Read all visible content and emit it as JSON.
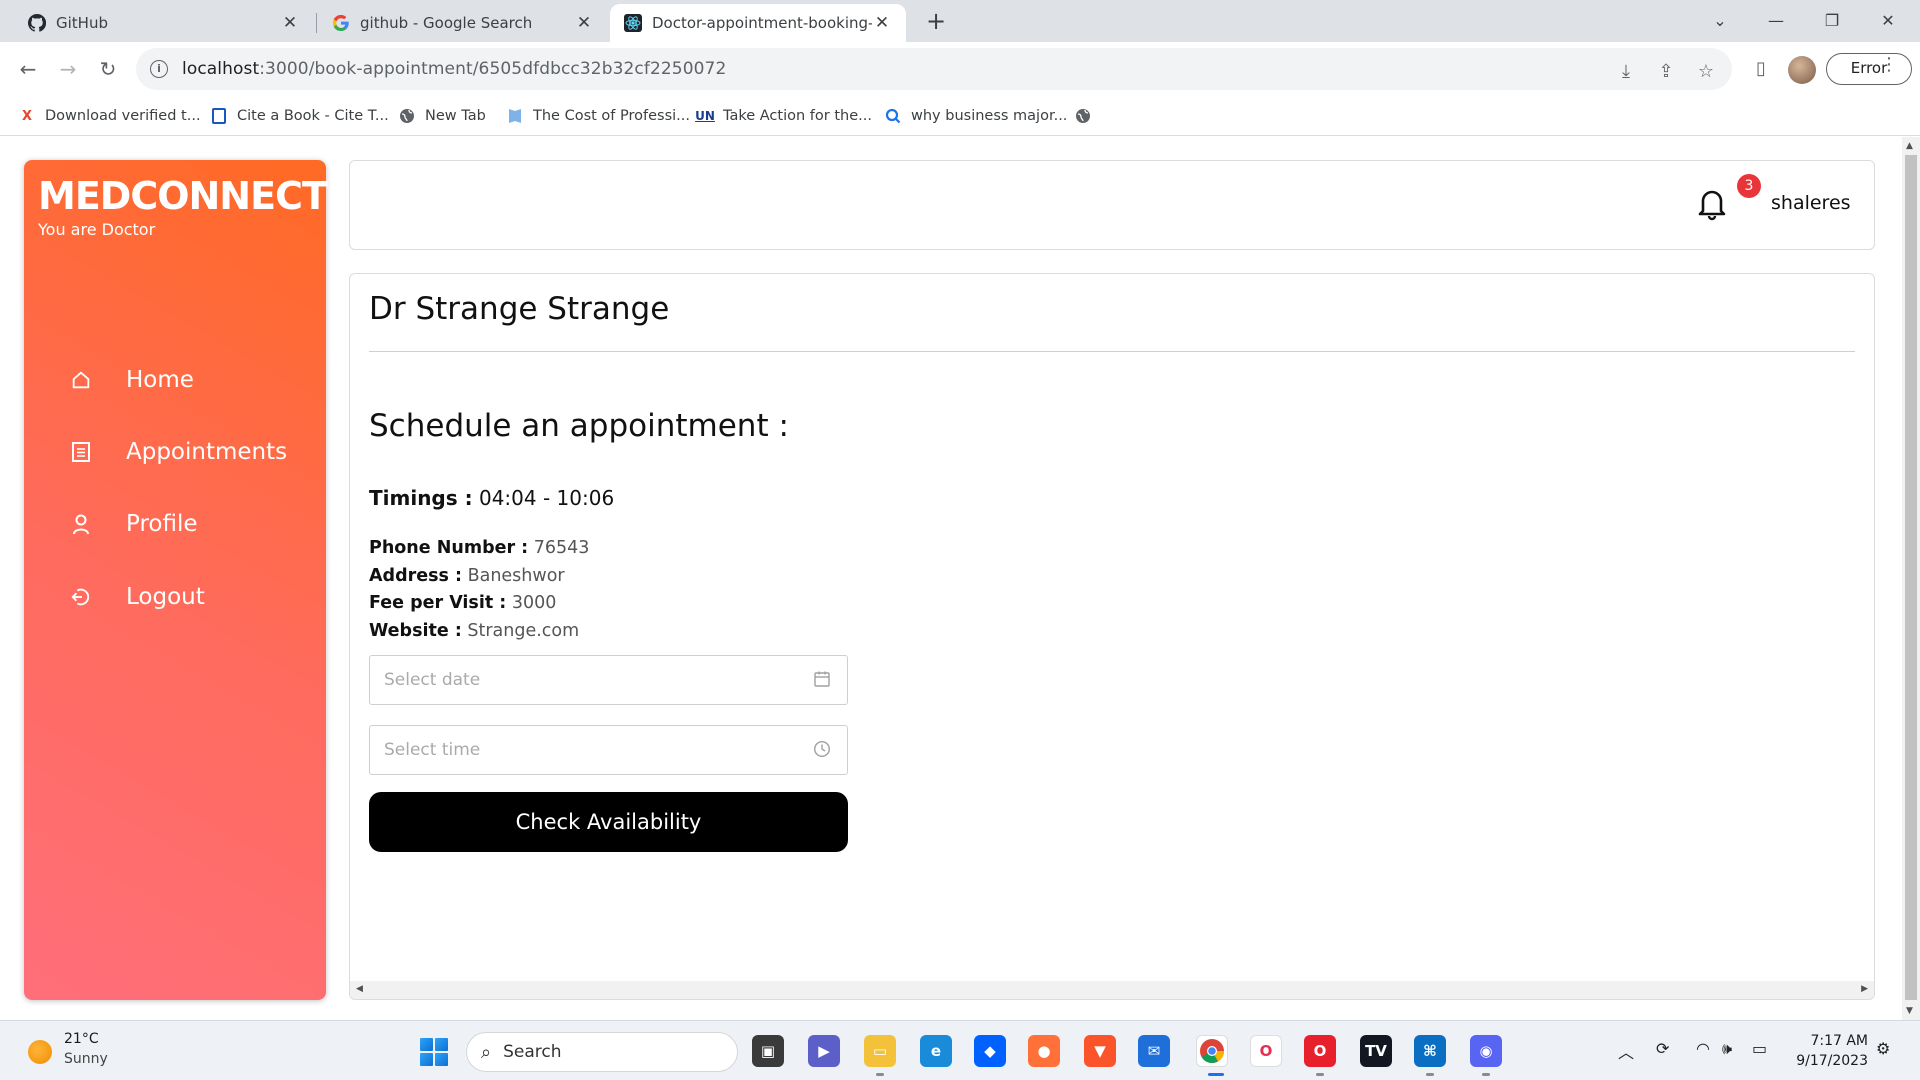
{
  "browser": {
    "tabs": [
      {
        "title": "GitHub",
        "icon": "github-icon",
        "active": false
      },
      {
        "title": "github - Google Search",
        "icon": "google-icon",
        "active": false
      },
      {
        "title": "Doctor-appointment-booking-ap",
        "icon": "react-icon",
        "active": true
      }
    ],
    "url": {
      "host": "localhost",
      "path": ":3000/book-appointment/6505dfdbcc32b32cf2250072"
    },
    "profile_button": "Error",
    "bookmarks": [
      {
        "label": "Download verified t...",
        "icon": "x-icon"
      },
      {
        "label": "Cite a Book - Cite T...",
        "icon": "book-icon"
      },
      {
        "label": "New Tab",
        "icon": "globe-icon"
      },
      {
        "label": "The Cost of Professi...",
        "icon": "bookmark-flag-icon"
      },
      {
        "label": "Take Action for the...",
        "icon": "un-icon"
      },
      {
        "label": "why business major...",
        "icon": "search-q-icon"
      }
    ]
  },
  "sidebar": {
    "brand": "MEDCONNECT",
    "role_text": "You are Doctor",
    "items": [
      {
        "label": "Home",
        "icon": "home-icon"
      },
      {
        "label": "Appointments",
        "icon": "list-icon"
      },
      {
        "label": "Profile",
        "icon": "user-icon"
      },
      {
        "label": "Logout",
        "icon": "logout-icon"
      }
    ]
  },
  "header": {
    "notification_count": "3",
    "username": "shaleres"
  },
  "doctor": {
    "name": "Dr Strange Strange",
    "schedule_heading": "Schedule an appointment :",
    "timings_label": "Timings :",
    "timings_value": " 04:04 - 10:06",
    "phone_label": "Phone Number :",
    "phone_value": " 76543",
    "address_label": "Address :",
    "address_value": " Baneshwor",
    "fee_label": "Fee per Visit :",
    "fee_value": " 3000",
    "website_label": "Website :",
    "website_value": " Strange.com"
  },
  "form": {
    "date_placeholder": "Select date",
    "time_placeholder": "Select time",
    "submit_label": "Check Availability"
  },
  "taskbar": {
    "temperature": "21°C",
    "condition": "Sunny",
    "search_label": "Search",
    "time": "7:17 AM",
    "date": "9/17/2023"
  },
  "colors": {
    "sidebar_gradient_start": "#ff6f7a",
    "sidebar_gradient_end": "#ff6a24",
    "badge": "#e8353a",
    "button": "#000000"
  }
}
